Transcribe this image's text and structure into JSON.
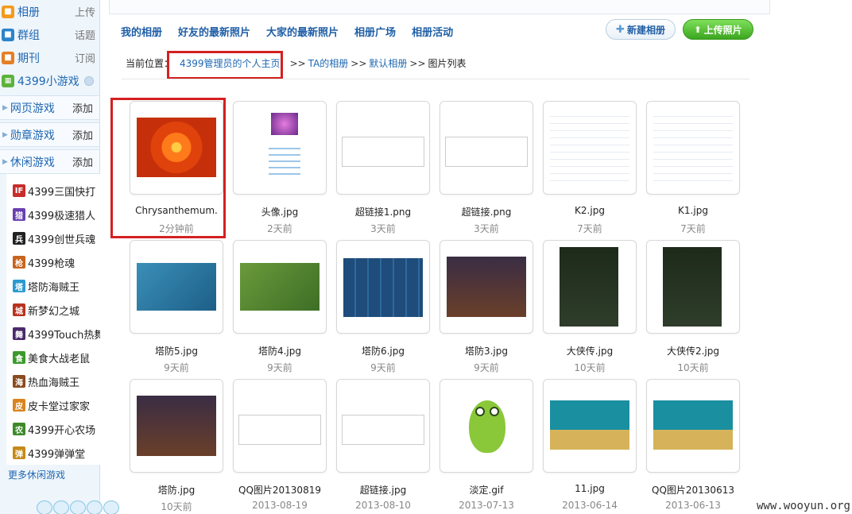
{
  "sidebar": {
    "top_items": [
      {
        "label": "相册",
        "right": "上传",
        "icon": "album-icon",
        "color": "#f39b1c"
      },
      {
        "label": "群组",
        "right": "话题",
        "icon": "group-icon",
        "color": "#2c84c8"
      },
      {
        "label": "期刊",
        "right": "订阅",
        "icon": "journal-icon",
        "color": "#e67e22"
      }
    ],
    "game_header": "4399小游戏",
    "sections": [
      {
        "label": "网页游戏",
        "add": "添加"
      },
      {
        "label": "勋章游戏",
        "add": "添加"
      },
      {
        "label": "休闲游戏",
        "add": "添加"
      }
    ],
    "games": [
      {
        "label": "4399三国快打",
        "glyph": "IF",
        "color": "#c62d2d"
      },
      {
        "label": "4399极速猎人",
        "glyph": "猎",
        "color": "#6a3fb0"
      },
      {
        "label": "4399创世兵魂",
        "glyph": "兵",
        "color": "#222222"
      },
      {
        "label": "4399枪魂",
        "glyph": "枪",
        "color": "#c7641f"
      },
      {
        "label": "塔防海贼王",
        "glyph": "塔",
        "color": "#2a9bd1"
      },
      {
        "label": "新梦幻之城",
        "glyph": "城",
        "color": "#b8321e"
      },
      {
        "label": "4399Touch热舞",
        "glyph": "舞",
        "color": "#4a2a6a"
      },
      {
        "label": "美食大战老鼠",
        "glyph": "食",
        "color": "#3c9a2c"
      },
      {
        "label": "热血海贼王",
        "glyph": "海",
        "color": "#8a4a1f"
      },
      {
        "label": "皮卡堂过家家",
        "glyph": "皮",
        "color": "#d9841f"
      },
      {
        "label": "4399开心农场",
        "glyph": "农",
        "color": "#3f8a2a"
      },
      {
        "label": "4399弹弹堂",
        "glyph": "弹",
        "color": "#c48a1a"
      }
    ],
    "more_link": "更多休闲游戏"
  },
  "nav": [
    "我的相册",
    "好友的最新照片",
    "大家的最新照片",
    "相册广场",
    "相册活动"
  ],
  "buttons": {
    "new_album": "新建相册",
    "upload": "上传照片"
  },
  "breadcrumb": {
    "prefix": "当前位置：",
    "home": "4399管理员的个人主页",
    "album_owner": "TA的相册",
    "album": "默认相册",
    "current": "图片列表",
    "sep": ">>"
  },
  "photos": [
    {
      "name": "Chrysanthemum.",
      "time": "2分钟前",
      "thumb": "flower"
    },
    {
      "name": "头像.jpg",
      "time": "2天前",
      "thumb": "avatar"
    },
    {
      "name": "超链接1.png",
      "time": "3天前",
      "thumb": "doc"
    },
    {
      "name": "超链接.png",
      "time": "3天前",
      "thumb": "doc"
    },
    {
      "name": "K2.jpg",
      "time": "7天前",
      "thumb": "text"
    },
    {
      "name": "K1.jpg",
      "time": "7天前",
      "thumb": "text"
    },
    {
      "name": "塔防5.jpg",
      "time": "9天前",
      "thumb": "game-blue"
    },
    {
      "name": "塔防4.jpg",
      "time": "9天前",
      "thumb": "game-green"
    },
    {
      "name": "塔防6.jpg",
      "time": "9天前",
      "thumb": "game-grid"
    },
    {
      "name": "塔防3.jpg",
      "time": "9天前",
      "thumb": "game-mix"
    },
    {
      "name": "大侠传.jpg",
      "time": "10天前",
      "thumb": "game-dark"
    },
    {
      "name": "大侠传2.jpg",
      "time": "10天前",
      "thumb": "game-dark"
    },
    {
      "name": "塔防.jpg",
      "time": "10天前",
      "thumb": "game-mix"
    },
    {
      "name": "QQ图片20130819",
      "time": "2013-08-19",
      "thumb": "doc"
    },
    {
      "name": "超链接.jpg",
      "time": "2013-08-10",
      "thumb": "doc"
    },
    {
      "name": "淡定.gif",
      "time": "2013-07-13",
      "thumb": "frog"
    },
    {
      "name": "11.jpg",
      "time": "2013-06-14",
      "thumb": "banner"
    },
    {
      "name": "QQ图片20130613",
      "time": "2013-06-13",
      "thumb": "banner"
    }
  ],
  "watermark": "www.wooyun.org"
}
